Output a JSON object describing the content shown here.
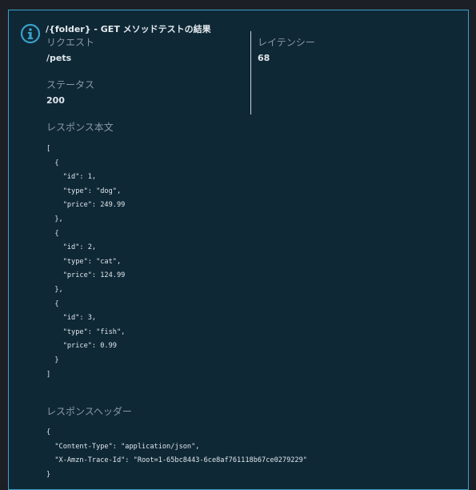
{
  "result": {
    "title": "/{folder} - GET メソッドテストの結果",
    "request_label": "リクエスト",
    "request_value": "/pets",
    "latency_label": "レイテンシー",
    "latency_value": "68",
    "status_label": "ステータス",
    "status_value": "200",
    "body_label": "レスポンス本文",
    "body_text": "[\n  {\n    \"id\": 1,\n    \"type\": \"dog\",\n    \"price\": 249.99\n  },\n  {\n    \"id\": 2,\n    \"type\": \"cat\",\n    \"price\": 124.99\n  },\n  {\n    \"id\": 3,\n    \"type\": \"fish\",\n    \"price\": 0.99\n  }\n]",
    "headers_label": "レスポンスヘッダー",
    "headers_text": "{\n  \"Content-Type\": \"application/json\",\n  \"X-Amzn-Trace-Id\": \"Root=1-65bc8443-6ce8af761118b67ce0279229\"\n}"
  },
  "icons": {
    "info": "info-circle-icon"
  },
  "colors": {
    "accent": "#3aa0c9",
    "panel_background": "#0f2836"
  }
}
